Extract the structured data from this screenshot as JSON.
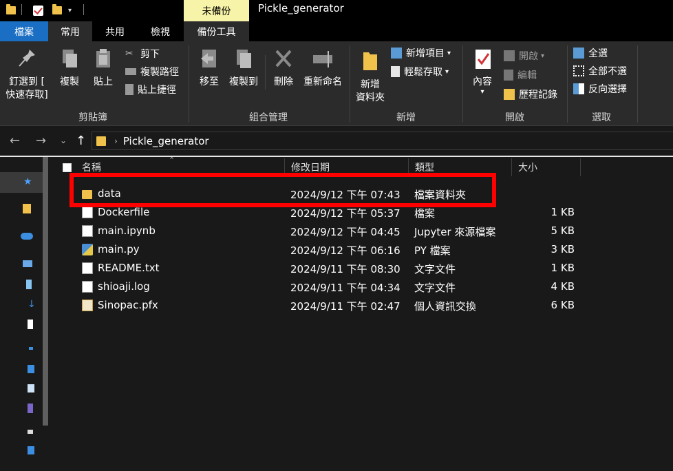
{
  "titlebar": {
    "tools_tab": "未備份",
    "window_title": "Pickle_generator"
  },
  "tabs": {
    "file": "檔案",
    "home": "常用",
    "share": "共用",
    "view": "檢視",
    "backup_tools": "備份工具"
  },
  "ribbon": {
    "clipboard": {
      "pin": "釘選到 [",
      "pin2": "快速存取]",
      "copy": "複製",
      "paste": "貼上",
      "cut": "剪下",
      "copy_path": "複製路徑",
      "paste_shortcut": "貼上捷徑",
      "label": "剪貼簿"
    },
    "organize": {
      "move_to": "移至",
      "copy_to": "複製到",
      "delete": "刪除",
      "rename": "重新命名",
      "label": "組合管理"
    },
    "new": {
      "new_folder": "新增",
      "new_folder2": "資料夾",
      "new_item": "新增項目",
      "easy_access": "輕鬆存取",
      "label": "新增"
    },
    "open": {
      "properties": "內容",
      "open": "開啟",
      "edit": "編輯",
      "history": "歷程記錄",
      "label": "開啟"
    },
    "select": {
      "select_all": "全選",
      "select_none": "全部不選",
      "invert": "反向選擇",
      "label": "選取"
    }
  },
  "address": {
    "path": "Pickle_generator"
  },
  "columns": {
    "name": "名稱",
    "modified": "修改日期",
    "type": "類型",
    "size": "大小"
  },
  "files": [
    {
      "name": "data",
      "modified": "2024/9/12 下午 07:43",
      "type": "檔案資料夾",
      "size": "",
      "icon": "folder-icon"
    },
    {
      "name": "Dockerfile",
      "modified": "2024/9/12 下午 05:37",
      "type": "檔案",
      "size": "1 KB",
      "icon": "file-icon"
    },
    {
      "name": "main.ipynb",
      "modified": "2024/9/12 下午 04:45",
      "type": "Jupyter 來源檔案",
      "size": "5 KB",
      "icon": "file-icon"
    },
    {
      "name": "main.py",
      "modified": "2024/9/12 下午 06:16",
      "type": "PY 檔案",
      "size": "3 KB",
      "icon": "python-file-icon"
    },
    {
      "name": "README.txt",
      "modified": "2024/9/11 下午 08:30",
      "type": "文字文件",
      "size": "1 KB",
      "icon": "text-file-icon"
    },
    {
      "name": "shioaji.log",
      "modified": "2024/9/11 下午 04:34",
      "type": "文字文件",
      "size": "4 KB",
      "icon": "text-file-icon"
    },
    {
      "name": "Sinopac.pfx",
      "modified": "2024/9/11 下午 02:47",
      "type": "個人資訊交換",
      "size": "6 KB",
      "icon": "certificate-file-icon"
    }
  ],
  "colors": {
    "accent": "#1a6fc4",
    "highlight": "#ff0000",
    "tools_tab": "#f7f3a8",
    "folder": "#f0c24b"
  }
}
